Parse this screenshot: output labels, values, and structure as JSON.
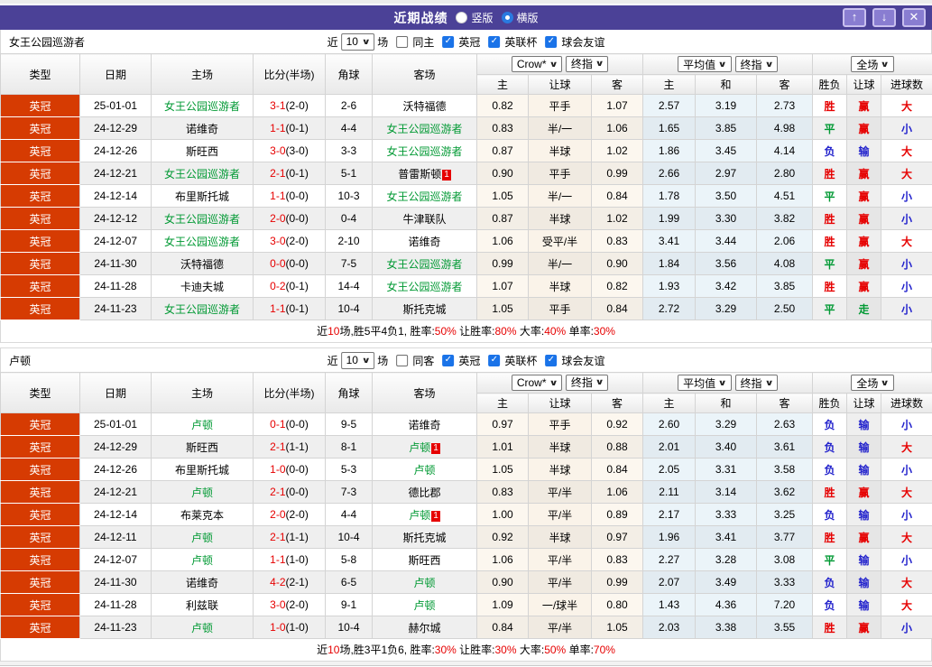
{
  "colors": {
    "titlebar_purple": "#4b4197",
    "button_purple": "#897dd1",
    "league_orange": "#d63b02",
    "win_red": "#e60000",
    "draw_green": "#009933",
    "lose_blue": "#2222cc",
    "crow_col_bg": "#fcf7ef",
    "avg_col_bg": "#ebf4f9"
  },
  "icons": {
    "check": "✓",
    "chevron": "∨",
    "up": "↑",
    "down": "↓",
    "close": "✕"
  },
  "titlebar": {
    "title": "近期战绩",
    "radios": [
      {
        "label": "竖版",
        "checked": false
      },
      {
        "label": "横版",
        "checked": true
      }
    ]
  },
  "table_columns": {
    "type": "类型",
    "date": "日期",
    "home": "主场",
    "score": "比分(半场)",
    "corner": "角球",
    "away": "客场",
    "crow_select": "Crow*",
    "final_select": "终指",
    "avg_select": "平均值",
    "fulltime_select": "全场",
    "crow_sub": [
      "主",
      "让球",
      "客"
    ],
    "avg_sub": [
      "主",
      "和",
      "客"
    ],
    "result_sub": [
      "胜负",
      "让球",
      "进球数"
    ]
  },
  "result_colors": {
    "胜": "#e60000",
    "平": "#009933",
    "负": "#2222cc",
    "赢": "#e60000",
    "走": "#009933",
    "输": "#2222cc",
    "大": "#e60000",
    "小": "#2222cc"
  },
  "sections": [
    {
      "team": "女王公园巡游者",
      "controls": {
        "near_label": "近",
        "match_count": "10",
        "matches_label": "场",
        "same_label": "同主",
        "same_checked": false,
        "leagues": [
          {
            "label": "英冠",
            "checked": true
          },
          {
            "label": "英联杯",
            "checked": true
          },
          {
            "label": "球会友谊",
            "checked": true
          }
        ]
      },
      "rows": [
        {
          "league": "英冠",
          "date": "25-01-01",
          "home": "女王公园巡游者",
          "home_green": true,
          "home_rc": 0,
          "ft": "3-1",
          "ht": "(2-0)",
          "corner": "2-6",
          "away": "沃特福德",
          "away_green": false,
          "away_rc": 0,
          "crow": [
            "0.82",
            "平手",
            "1.07"
          ],
          "avg": [
            "2.57",
            "3.19",
            "2.73"
          ],
          "result": [
            "胜",
            "赢",
            "大"
          ]
        },
        {
          "league": "英冠",
          "date": "24-12-29",
          "home": "诺维奇",
          "home_green": false,
          "home_rc": 0,
          "ft": "1-1",
          "ht": "(0-1)",
          "corner": "4-4",
          "away": "女王公园巡游者",
          "away_green": true,
          "away_rc": 0,
          "crow": [
            "0.83",
            "半/一",
            "1.06"
          ],
          "avg": [
            "1.65",
            "3.85",
            "4.98"
          ],
          "result": [
            "平",
            "赢",
            "小"
          ]
        },
        {
          "league": "英冠",
          "date": "24-12-26",
          "home": "斯旺西",
          "home_green": false,
          "home_rc": 0,
          "ft": "3-0",
          "ht": "(3-0)",
          "corner": "3-3",
          "away": "女王公园巡游者",
          "away_green": true,
          "away_rc": 0,
          "crow": [
            "0.87",
            "半球",
            "1.02"
          ],
          "avg": [
            "1.86",
            "3.45",
            "4.14"
          ],
          "result": [
            "负",
            "输",
            "大"
          ]
        },
        {
          "league": "英冠",
          "date": "24-12-21",
          "home": "女王公园巡游者",
          "home_green": true,
          "home_rc": 0,
          "ft": "2-1",
          "ht": "(0-1)",
          "corner": "5-1",
          "away": "普雷斯顿",
          "away_green": false,
          "away_rc": 1,
          "crow": [
            "0.90",
            "平手",
            "0.99"
          ],
          "avg": [
            "2.66",
            "2.97",
            "2.80"
          ],
          "result": [
            "胜",
            "赢",
            "大"
          ]
        },
        {
          "league": "英冠",
          "date": "24-12-14",
          "home": "布里斯托城",
          "home_green": false,
          "home_rc": 0,
          "ft": "1-1",
          "ht": "(0-0)",
          "corner": "10-3",
          "away": "女王公园巡游者",
          "away_green": true,
          "away_rc": 0,
          "crow": [
            "1.05",
            "半/一",
            "0.84"
          ],
          "avg": [
            "1.78",
            "3.50",
            "4.51"
          ],
          "result": [
            "平",
            "赢",
            "小"
          ]
        },
        {
          "league": "英冠",
          "date": "24-12-12",
          "home": "女王公园巡游者",
          "home_green": true,
          "home_rc": 0,
          "ft": "2-0",
          "ht": "(0-0)",
          "corner": "0-4",
          "away": "牛津联队",
          "away_green": false,
          "away_rc": 0,
          "crow": [
            "0.87",
            "半球",
            "1.02"
          ],
          "avg": [
            "1.99",
            "3.30",
            "3.82"
          ],
          "result": [
            "胜",
            "赢",
            "小"
          ]
        },
        {
          "league": "英冠",
          "date": "24-12-07",
          "home": "女王公园巡游者",
          "home_green": true,
          "home_rc": 0,
          "ft": "3-0",
          "ht": "(2-0)",
          "corner": "2-10",
          "away": "诺维奇",
          "away_green": false,
          "away_rc": 0,
          "crow": [
            "1.06",
            "受平/半",
            "0.83"
          ],
          "avg": [
            "3.41",
            "3.44",
            "2.06"
          ],
          "result": [
            "胜",
            "赢",
            "大"
          ]
        },
        {
          "league": "英冠",
          "date": "24-11-30",
          "home": "沃特福德",
          "home_green": false,
          "home_rc": 0,
          "ft": "0-0",
          "ht": "(0-0)",
          "corner": "7-5",
          "away": "女王公园巡游者",
          "away_green": true,
          "away_rc": 0,
          "crow": [
            "0.99",
            "半/一",
            "0.90"
          ],
          "avg": [
            "1.84",
            "3.56",
            "4.08"
          ],
          "result": [
            "平",
            "赢",
            "小"
          ]
        },
        {
          "league": "英冠",
          "date": "24-11-28",
          "home": "卡迪夫城",
          "home_green": false,
          "home_rc": 0,
          "ft": "0-2",
          "ht": "(0-1)",
          "corner": "14-4",
          "away": "女王公园巡游者",
          "away_green": true,
          "away_rc": 0,
          "crow": [
            "1.07",
            "半球",
            "0.82"
          ],
          "avg": [
            "1.93",
            "3.42",
            "3.85"
          ],
          "result": [
            "胜",
            "赢",
            "小"
          ]
        },
        {
          "league": "英冠",
          "date": "24-11-23",
          "home": "女王公园巡游者",
          "home_green": true,
          "home_rc": 0,
          "ft": "1-1",
          "ht": "(0-1)",
          "corner": "10-4",
          "away": "斯托克城",
          "away_green": false,
          "away_rc": 0,
          "crow": [
            "1.05",
            "平手",
            "0.84"
          ],
          "avg": [
            "2.72",
            "3.29",
            "2.50"
          ],
          "result": [
            "平",
            "走",
            "小"
          ]
        }
      ],
      "summary": [
        {
          "text": "近",
          "red": false
        },
        {
          "text": "10",
          "red": true
        },
        {
          "text": "场,胜5平4负1, 胜率:",
          "red": false
        },
        {
          "text": "50%",
          "red": true
        },
        {
          "text": " 让胜率:",
          "red": false
        },
        {
          "text": "80%",
          "red": true
        },
        {
          "text": " 大率:",
          "red": false
        },
        {
          "text": "40%",
          "red": true
        },
        {
          "text": " 单率:",
          "red": false
        },
        {
          "text": "30%",
          "red": true
        }
      ]
    },
    {
      "team": "卢顿",
      "controls": {
        "near_label": "近",
        "match_count": "10",
        "matches_label": "场",
        "same_label": "同客",
        "same_checked": false,
        "leagues": [
          {
            "label": "英冠",
            "checked": true
          },
          {
            "label": "英联杯",
            "checked": true
          },
          {
            "label": "球会友谊",
            "checked": true
          }
        ]
      },
      "rows": [
        {
          "league": "英冠",
          "date": "25-01-01",
          "home": "卢顿",
          "home_green": true,
          "home_rc": 0,
          "ft": "0-1",
          "ht": "(0-0)",
          "corner": "9-5",
          "away": "诺维奇",
          "away_green": false,
          "away_rc": 0,
          "crow": [
            "0.97",
            "平手",
            "0.92"
          ],
          "avg": [
            "2.60",
            "3.29",
            "2.63"
          ],
          "result": [
            "负",
            "输",
            "小"
          ]
        },
        {
          "league": "英冠",
          "date": "24-12-29",
          "home": "斯旺西",
          "home_green": false,
          "home_rc": 0,
          "ft": "2-1",
          "ht": "(1-1)",
          "corner": "8-1",
          "away": "卢顿",
          "away_green": true,
          "away_rc": 1,
          "crow": [
            "1.01",
            "半球",
            "0.88"
          ],
          "avg": [
            "2.01",
            "3.40",
            "3.61"
          ],
          "result": [
            "负",
            "输",
            "大"
          ]
        },
        {
          "league": "英冠",
          "date": "24-12-26",
          "home": "布里斯托城",
          "home_green": false,
          "home_rc": 0,
          "ft": "1-0",
          "ht": "(0-0)",
          "corner": "5-3",
          "away": "卢顿",
          "away_green": true,
          "away_rc": 0,
          "crow": [
            "1.05",
            "半球",
            "0.84"
          ],
          "avg": [
            "2.05",
            "3.31",
            "3.58"
          ],
          "result": [
            "负",
            "输",
            "小"
          ]
        },
        {
          "league": "英冠",
          "date": "24-12-21",
          "home": "卢顿",
          "home_green": true,
          "home_rc": 0,
          "ft": "2-1",
          "ht": "(0-0)",
          "corner": "7-3",
          "away": "德比郡",
          "away_green": false,
          "away_rc": 0,
          "crow": [
            "0.83",
            "平/半",
            "1.06"
          ],
          "avg": [
            "2.11",
            "3.14",
            "3.62"
          ],
          "result": [
            "胜",
            "赢",
            "大"
          ]
        },
        {
          "league": "英冠",
          "date": "24-12-14",
          "home": "布莱克本",
          "home_green": false,
          "home_rc": 0,
          "ft": "2-0",
          "ht": "(2-0)",
          "corner": "4-4",
          "away": "卢顿",
          "away_green": true,
          "away_rc": 1,
          "crow": [
            "1.00",
            "平/半",
            "0.89"
          ],
          "avg": [
            "2.17",
            "3.33",
            "3.25"
          ],
          "result": [
            "负",
            "输",
            "小"
          ]
        },
        {
          "league": "英冠",
          "date": "24-12-11",
          "home": "卢顿",
          "home_green": true,
          "home_rc": 0,
          "ft": "2-1",
          "ht": "(1-1)",
          "corner": "10-4",
          "away": "斯托克城",
          "away_green": false,
          "away_rc": 0,
          "crow": [
            "0.92",
            "半球",
            "0.97"
          ],
          "avg": [
            "1.96",
            "3.41",
            "3.77"
          ],
          "result": [
            "胜",
            "赢",
            "大"
          ]
        },
        {
          "league": "英冠",
          "date": "24-12-07",
          "home": "卢顿",
          "home_green": true,
          "home_rc": 0,
          "ft": "1-1",
          "ht": "(1-0)",
          "corner": "5-8",
          "away": "斯旺西",
          "away_green": false,
          "away_rc": 0,
          "crow": [
            "1.06",
            "平/半",
            "0.83"
          ],
          "avg": [
            "2.27",
            "3.28",
            "3.08"
          ],
          "result": [
            "平",
            "输",
            "小"
          ]
        },
        {
          "league": "英冠",
          "date": "24-11-30",
          "home": "诺维奇",
          "home_green": false,
          "home_rc": 0,
          "ft": "4-2",
          "ht": "(2-1)",
          "corner": "6-5",
          "away": "卢顿",
          "away_green": true,
          "away_rc": 0,
          "crow": [
            "0.90",
            "平/半",
            "0.99"
          ],
          "avg": [
            "2.07",
            "3.49",
            "3.33"
          ],
          "result": [
            "负",
            "输",
            "大"
          ]
        },
        {
          "league": "英冠",
          "date": "24-11-28",
          "home": "利兹联",
          "home_green": false,
          "home_rc": 0,
          "ft": "3-0",
          "ht": "(2-0)",
          "corner": "9-1",
          "away": "卢顿",
          "away_green": true,
          "away_rc": 0,
          "crow": [
            "1.09",
            "一/球半",
            "0.80"
          ],
          "avg": [
            "1.43",
            "4.36",
            "7.20"
          ],
          "result": [
            "负",
            "输",
            "大"
          ]
        },
        {
          "league": "英冠",
          "date": "24-11-23",
          "home": "卢顿",
          "home_green": true,
          "home_rc": 0,
          "ft": "1-0",
          "ht": "(1-0)",
          "corner": "10-4",
          "away": "赫尔城",
          "away_green": false,
          "away_rc": 0,
          "crow": [
            "0.84",
            "平/半",
            "1.05"
          ],
          "avg": [
            "2.03",
            "3.38",
            "3.55"
          ],
          "result": [
            "胜",
            "赢",
            "小"
          ]
        }
      ],
      "summary": [
        {
          "text": "近",
          "red": false
        },
        {
          "text": "10",
          "red": true
        },
        {
          "text": "场,胜3平1负6, 胜率:",
          "red": false
        },
        {
          "text": "30%",
          "red": true
        },
        {
          "text": " 让胜率:",
          "red": false
        },
        {
          "text": "30%",
          "red": true
        },
        {
          "text": " 大率:",
          "red": false
        },
        {
          "text": "50%",
          "red": true
        },
        {
          "text": " 单率:",
          "red": false
        },
        {
          "text": "70%",
          "red": true
        }
      ]
    }
  ]
}
